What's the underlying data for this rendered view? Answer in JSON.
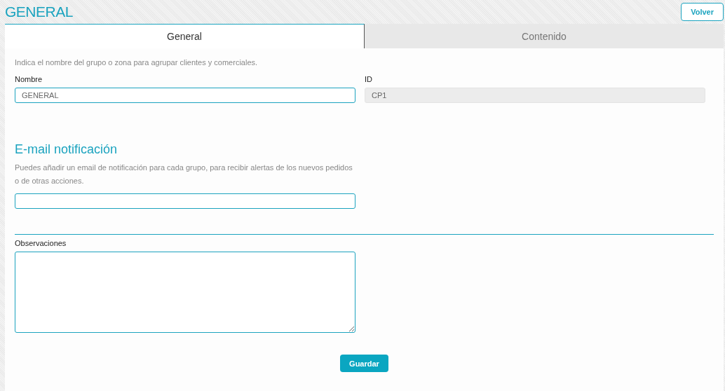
{
  "page": {
    "title": "GENERAL",
    "back_button": "Volver"
  },
  "tabs": [
    {
      "label": "General",
      "selected": true
    },
    {
      "label": "Contenido",
      "selected": false
    }
  ],
  "intro": "Indica el nombre del grupo o zona para agrupar clientes y comerciales.",
  "fields": [
    {
      "label": "Nombre",
      "value": "GENERAL",
      "disabled": false
    },
    {
      "label": "ID",
      "value": "CP1",
      "disabled": true
    }
  ],
  "email_section": {
    "heading": "E-mail notificación",
    "description": "Puedes añadir un email de notificación para cada grupo, para recibir alertas de los nuevos pedidos o de otras acciones."
  },
  "notes": {
    "label": "Observaciones"
  },
  "save_button": "Guardar"
}
